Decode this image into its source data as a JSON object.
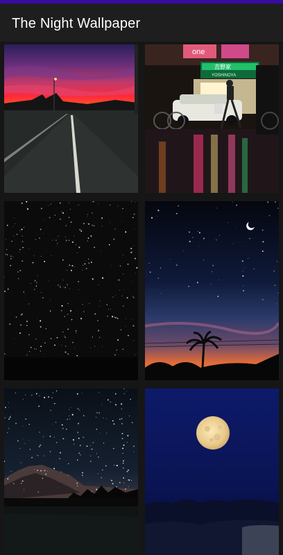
{
  "app": {
    "title": "The Night Wallpaper",
    "status_bar_color": "#3a0ca3",
    "background_color": "#121212"
  },
  "wallpapers": [
    {
      "name": "sunset-road",
      "icon": "sunset-road-image"
    },
    {
      "name": "neon-street",
      "icon": "neon-street-image"
    },
    {
      "name": "starry-sky",
      "icon": "starry-sky-image"
    },
    {
      "name": "palm-dusk-moon",
      "icon": "palm-dusk-image"
    },
    {
      "name": "mountain-stars",
      "icon": "mountain-stars-image"
    },
    {
      "name": "full-moon",
      "icon": "full-moon-image"
    }
  ],
  "storefront_sign": {
    "top": "吉野家",
    "bottom": "YOSHINOYA",
    "banner": "one"
  }
}
